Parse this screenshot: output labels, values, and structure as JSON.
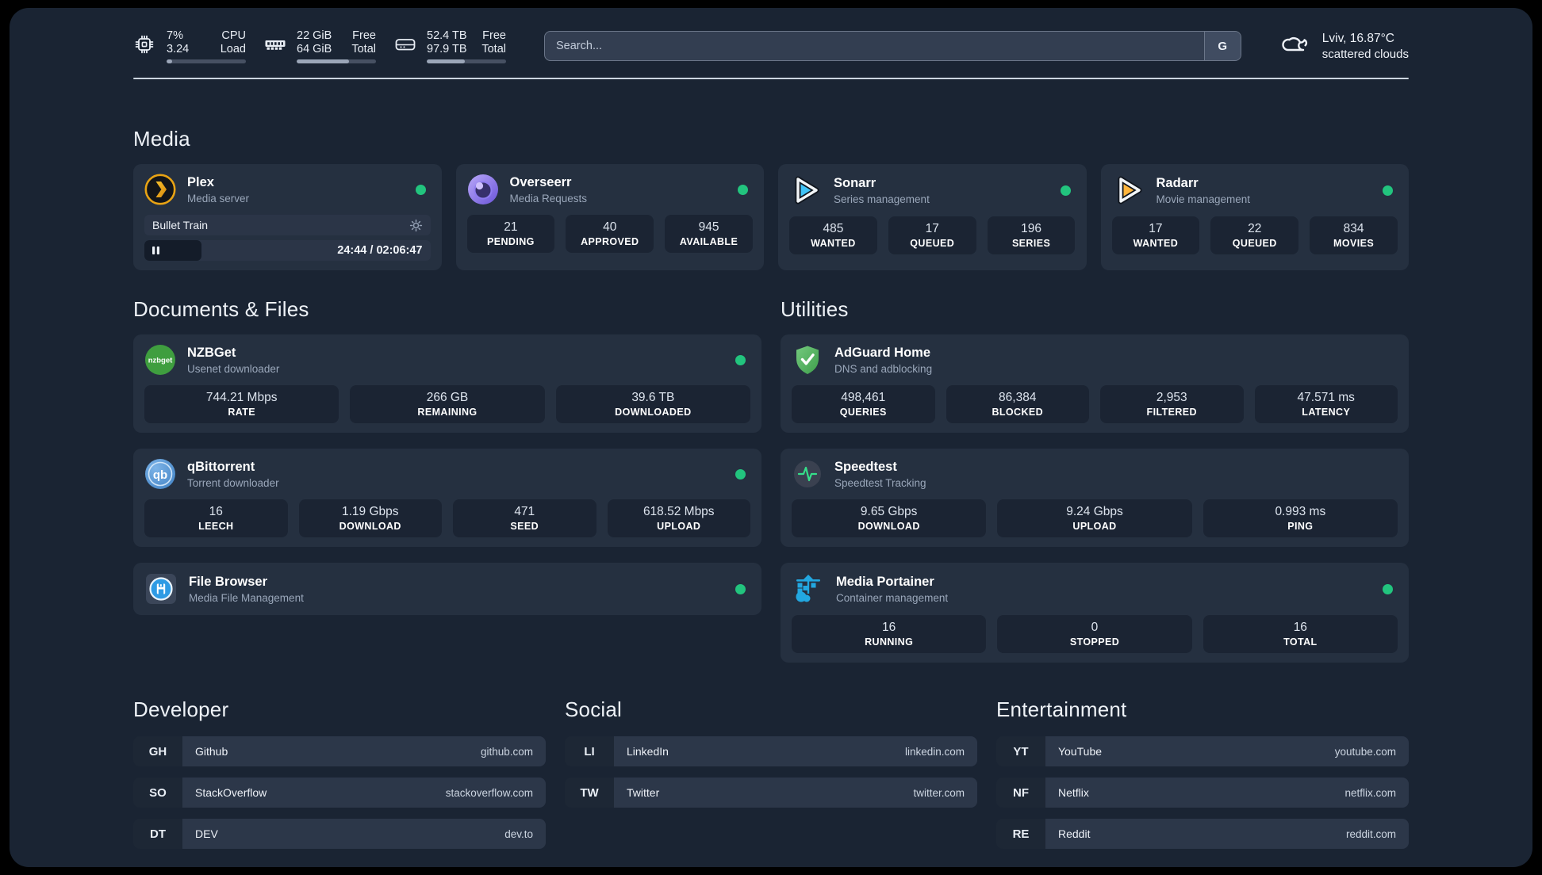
{
  "colors": {
    "status_online": "#22c47e",
    "portainer_blue": "#22a7e0",
    "plex_gold": "#e8a314",
    "sonarr_blue": "#3fc3f7",
    "radarr_orange": "#ffb53c",
    "nzbget_green": "#3f9e3f",
    "adguard_green": "#53b15f",
    "speedtest_pulse": "#35e08a"
  },
  "header": {
    "system_stats": [
      {
        "icon": "cpu-icon",
        "rows": [
          {
            "value": "7%",
            "label": "CPU"
          },
          {
            "value": "3.24",
            "label": "Load"
          }
        ],
        "progress_pct": 7
      },
      {
        "icon": "memory-icon",
        "rows": [
          {
            "value": "22 GiB",
            "label": "Free"
          },
          {
            "value": "64 GiB",
            "label": "Total"
          }
        ],
        "progress_pct": 66
      },
      {
        "icon": "disk-icon",
        "rows": [
          {
            "value": "52.4 TB",
            "label": "Free"
          },
          {
            "value": "97.9 TB",
            "label": "Total"
          }
        ],
        "progress_pct": 48
      }
    ],
    "search": {
      "placeholder": "Search...",
      "engine_button": "G"
    },
    "weather": {
      "icon": "cloud-icon",
      "location": "Lviv, 16.87°C",
      "condition": "scattered clouds"
    }
  },
  "app_sections": [
    {
      "id": "media",
      "title": "Media",
      "apps": [
        {
          "icon": "plex-icon",
          "name": "Plex",
          "description": "Media server",
          "online": true,
          "player": {
            "title": "Bullet Train",
            "time": "24:44 / 02:06:47",
            "progress_pct": 20
          }
        },
        {
          "icon": "overseerr-icon",
          "name": "Overseerr",
          "description": "Media Requests",
          "online": true,
          "stats": [
            {
              "value": "21",
              "label": "PENDING"
            },
            {
              "value": "40",
              "label": "APPROVED"
            },
            {
              "value": "945",
              "label": "AVAILABLE"
            }
          ]
        },
        {
          "icon": "sonarr-icon",
          "name": "Sonarr",
          "description": "Series management",
          "online": true,
          "stats": [
            {
              "value": "485",
              "label": "WANTED"
            },
            {
              "value": "17",
              "label": "QUEUED"
            },
            {
              "value": "196",
              "label": "SERIES"
            }
          ]
        },
        {
          "icon": "radarr-icon",
          "name": "Radarr",
          "description": "Movie management",
          "online": true,
          "stats": [
            {
              "value": "17",
              "label": "WANTED"
            },
            {
              "value": "22",
              "label": "QUEUED"
            },
            {
              "value": "834",
              "label": "MOVIES"
            }
          ]
        }
      ]
    },
    {
      "id": "documents",
      "title": "Documents & Files",
      "apps": [
        {
          "icon": "nzbget-icon",
          "name": "NZBGet",
          "description": "Usenet downloader",
          "online": true,
          "stats": [
            {
              "value": "744.21 Mbps",
              "label": "RATE"
            },
            {
              "value": "266 GB",
              "label": "REMAINING"
            },
            {
              "value": "39.6 TB",
              "label": "DOWNLOADED"
            }
          ]
        },
        {
          "icon": "qbittorrent-icon",
          "name": "qBittorrent",
          "description": "Torrent downloader",
          "online": true,
          "stats": [
            {
              "value": "16",
              "label": "LEECH"
            },
            {
              "value": "1.19 Gbps",
              "label": "DOWNLOAD"
            },
            {
              "value": "471",
              "label": "SEED"
            },
            {
              "value": "618.52 Mbps",
              "label": "UPLOAD"
            }
          ]
        },
        {
          "icon": "filebrowser-icon",
          "name": "File Browser",
          "description": "Media File Management",
          "online": true
        }
      ]
    },
    {
      "id": "utilities",
      "title": "Utilities",
      "apps": [
        {
          "icon": "adguard-icon",
          "name": "AdGuard Home",
          "description": "DNS and adblocking",
          "online": false,
          "stats": [
            {
              "value": "498,461",
              "label": "QUERIES"
            },
            {
              "value": "86,384",
              "label": "BLOCKED"
            },
            {
              "value": "2,953",
              "label": "FILTERED"
            },
            {
              "value": "47.571 ms",
              "label": "LATENCY"
            }
          ]
        },
        {
          "icon": "speedtest-icon",
          "name": "Speedtest",
          "description": "Speedtest Tracking",
          "online": false,
          "stats": [
            {
              "value": "9.65 Gbps",
              "label": "DOWNLOAD"
            },
            {
              "value": "9.24 Gbps",
              "label": "UPLOAD"
            },
            {
              "value": "0.993 ms",
              "label": "PING"
            }
          ]
        },
        {
          "icon": "portainer-icon",
          "name": "Media Portainer",
          "description": "Container management",
          "online": true,
          "stats": [
            {
              "value": "16",
              "label": "RUNNING"
            },
            {
              "value": "0",
              "label": "STOPPED"
            },
            {
              "value": "16",
              "label": "TOTAL"
            }
          ]
        }
      ]
    }
  ],
  "bookmark_sections": [
    {
      "title": "Developer",
      "links": [
        {
          "abbr": "GH",
          "name": "Github",
          "url": "github.com"
        },
        {
          "abbr": "SO",
          "name": "StackOverflow",
          "url": "stackoverflow.com"
        },
        {
          "abbr": "DT",
          "name": "DEV",
          "url": "dev.to"
        }
      ]
    },
    {
      "title": "Social",
      "links": [
        {
          "abbr": "LI",
          "name": "LinkedIn",
          "url": "linkedin.com"
        },
        {
          "abbr": "TW",
          "name": "Twitter",
          "url": "twitter.com"
        }
      ]
    },
    {
      "title": "Entertainment",
      "links": [
        {
          "abbr": "YT",
          "name": "YouTube",
          "url": "youtube.com"
        },
        {
          "abbr": "NF",
          "name": "Netflix",
          "url": "netflix.com"
        },
        {
          "abbr": "RE",
          "name": "Reddit",
          "url": "reddit.com"
        }
      ]
    }
  ]
}
